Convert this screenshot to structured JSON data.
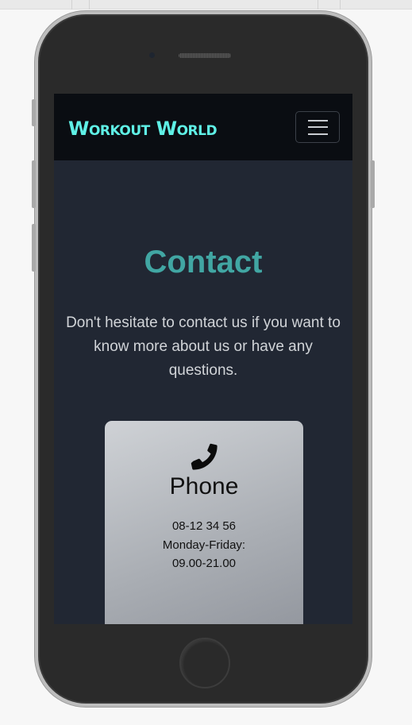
{
  "nav": {
    "brand": "Workout World",
    "menu_button_icon": "hamburger-icon"
  },
  "contact": {
    "title": "Contact",
    "intro": "Don't hesitate to contact us if you want to know more about us or have any questions."
  },
  "phone_card": {
    "icon": "phone-icon",
    "title": "Phone",
    "number": "08-12 34 56",
    "hours_label": "Monday-Friday:",
    "hours": "09.00-21.00"
  },
  "colors": {
    "brand": "#5ff0e6",
    "title_accent": "#41a6a3",
    "page_bg": "#212733",
    "navbar_bg": "#0a0d12"
  }
}
